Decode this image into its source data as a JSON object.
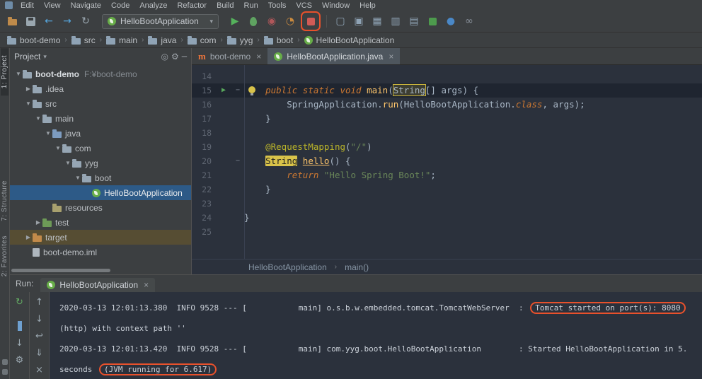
{
  "menu": {
    "items": [
      "Edit",
      "View",
      "Navigate",
      "Code",
      "Analyze",
      "Refactor",
      "Build",
      "Run",
      "Tools",
      "VCS",
      "Window",
      "Help"
    ]
  },
  "toolbar": {
    "run_config": "HelloBootApplication",
    "left": [
      {
        "name": "open-icon",
        "glyph": "folder",
        "color": "#be8a4a"
      },
      {
        "name": "save-icon",
        "glyph": "floppy"
      },
      {
        "name": "back-icon",
        "glyph": "←",
        "color": "#56a8e0"
      },
      {
        "name": "forward-icon",
        "glyph": "→",
        "color": "#56a8e0"
      },
      {
        "name": "refresh-icon",
        "glyph": "↻",
        "color": "#9aa7b0"
      }
    ],
    "run_group": [
      {
        "name": "run-icon",
        "glyph": "▶",
        "color": "#55b25c"
      },
      {
        "name": "debug-icon",
        "glyph": "bug"
      },
      {
        "name": "coverage-icon",
        "glyph": "◉",
        "color": "#b0575a"
      },
      {
        "name": "profiler-icon",
        "glyph": "◔",
        "color": "#c98a3f"
      },
      {
        "name": "stop-icon",
        "glyph": "square",
        "color": "#cf5b56",
        "boxed": true
      }
    ],
    "right": [
      {
        "name": "window-icon",
        "glyph": "▢",
        "color": "#8fa3b5"
      },
      {
        "name": "dock-icon",
        "glyph": "▣",
        "color": "#8fa3b5"
      },
      {
        "name": "grid-icon",
        "glyph": "▦",
        "color": "#8fa3b5"
      },
      {
        "name": "columns-icon",
        "glyph": "▥",
        "color": "#8fa3b5"
      },
      {
        "name": "screens-icon",
        "glyph": "▤",
        "color": "#8fa3b5"
      },
      {
        "name": "green-badge-icon",
        "glyph": "square",
        "color": "#4d9b4d"
      },
      {
        "name": "blue-circle-icon",
        "glyph": "●",
        "color": "#4a88c7"
      },
      {
        "name": "link-icon",
        "glyph": "∞",
        "color": "#88909a"
      }
    ]
  },
  "navbar": {
    "items": [
      {
        "label": "boot-demo",
        "icon": "folder"
      },
      {
        "label": "src",
        "icon": "folder"
      },
      {
        "label": "main",
        "icon": "folder"
      },
      {
        "label": "java",
        "icon": "folder"
      },
      {
        "label": "com",
        "icon": "folder"
      },
      {
        "label": "yyg",
        "icon": "folder"
      },
      {
        "label": "boot",
        "icon": "folder"
      },
      {
        "label": "HelloBootApplication",
        "icon": "spring"
      }
    ]
  },
  "strip": {
    "top": [
      {
        "label": "1: Project",
        "active": true
      }
    ],
    "bottom": [
      {
        "label": "7: Structure"
      },
      {
        "label": "2: Favorites"
      }
    ]
  },
  "project": {
    "title": "Project",
    "tree": [
      {
        "label": "boot-demo",
        "path": "F:¥boot-demo",
        "indent": 0,
        "arrow": "v",
        "icon": "folder",
        "bold": true
      },
      {
        "label": ".idea",
        "indent": 1,
        "arrow": "c",
        "icon": "folder"
      },
      {
        "label": "src",
        "indent": 1,
        "arrow": "v",
        "icon": "folder"
      },
      {
        "label": "main",
        "indent": 2,
        "arrow": "v",
        "icon": "folder"
      },
      {
        "label": "java",
        "indent": 3,
        "arrow": "v",
        "icon": "folder",
        "color": "#7d9cc0"
      },
      {
        "label": "com",
        "indent": 4,
        "arrow": "v",
        "icon": "folder"
      },
      {
        "label": "yyg",
        "indent": 5,
        "arrow": "v",
        "icon": "folder"
      },
      {
        "label": "boot",
        "indent": 6,
        "arrow": "v",
        "icon": "folder"
      },
      {
        "label": "HelloBootApplication",
        "indent": 7,
        "arrow": "",
        "icon": "spring",
        "sel": true
      },
      {
        "label": "resources",
        "indent": 3,
        "arrow": "",
        "icon": "folder",
        "color": "#a8a06e"
      },
      {
        "label": "test",
        "indent": 2,
        "arrow": "c",
        "icon": "folder",
        "color": "#6d9a57"
      },
      {
        "label": "target",
        "indent": 1,
        "arrow": "c",
        "icon": "folder",
        "color": "#c28a4a",
        "olive": true
      },
      {
        "label": "boot-demo.iml",
        "indent": 1,
        "arrow": "",
        "icon": "file"
      }
    ]
  },
  "editor": {
    "tabs": [
      {
        "label": "boot-demo",
        "icon": "maven",
        "active": false
      },
      {
        "label": "HelloBootApplication.java",
        "icon": "spring",
        "active": true
      }
    ],
    "breadcrumb": [
      "HelloBootApplication",
      "main()"
    ],
    "lines": [
      {
        "n": 14,
        "segs": []
      },
      {
        "n": 15,
        "current": true,
        "run": true,
        "bulb": true,
        "fold": "−",
        "segs": [
          {
            "t": "    ",
            "c": "pl"
          },
          {
            "t": "public static void ",
            "c": "kw"
          },
          {
            "t": "main",
            "c": "meth"
          },
          {
            "t": "(",
            "c": "pl"
          },
          {
            "t": "String",
            "c": "cbox"
          },
          {
            "t": "[] args) {",
            "c": "pl"
          }
        ]
      },
      {
        "n": 16,
        "segs": [
          {
            "t": "        SpringApplication.",
            "c": "pl"
          },
          {
            "t": "run",
            "c": "meth"
          },
          {
            "t": "(HelloBootApplication.",
            "c": "pl"
          },
          {
            "t": "class",
            "c": "kw"
          },
          {
            "t": ", args);",
            "c": "pl"
          }
        ]
      },
      {
        "n": 17,
        "segs": [
          {
            "t": "    }",
            "c": "pl"
          }
        ]
      },
      {
        "n": 18,
        "segs": []
      },
      {
        "n": 19,
        "segs": [
          {
            "t": "    ",
            "c": "pl"
          },
          {
            "t": "@RequestMapping",
            "c": "ann"
          },
          {
            "t": "(",
            "c": "pl"
          },
          {
            "t": "\"/\"",
            "c": "str"
          },
          {
            "t": ")",
            "c": "pl"
          }
        ]
      },
      {
        "n": 20,
        "fold": "−",
        "segs": [
          {
            "t": "    ",
            "c": "pl"
          },
          {
            "t": "String",
            "c": "fbox"
          },
          {
            "t": " ",
            "c": "pl"
          },
          {
            "t": "hello",
            "c": "mdecl"
          },
          {
            "t": "() {",
            "c": "pl"
          }
        ]
      },
      {
        "n": 21,
        "segs": [
          {
            "t": "        ",
            "c": "pl"
          },
          {
            "t": "return ",
            "c": "kw"
          },
          {
            "t": "\"Hello Spring Boot!\"",
            "c": "str"
          },
          {
            "t": ";",
            "c": "pl"
          }
        ]
      },
      {
        "n": 22,
        "segs": [
          {
            "t": "    }",
            "c": "pl"
          }
        ]
      },
      {
        "n": 23,
        "segs": []
      },
      {
        "n": 24,
        "segs": [
          {
            "t": "}",
            "c": "pl"
          }
        ]
      },
      {
        "n": 25,
        "segs": []
      }
    ]
  },
  "run": {
    "label": "Run:",
    "tab": "HelloBootApplication",
    "col1": [
      {
        "name": "rerun-icon",
        "glyph": "↻",
        "color": "#62a862"
      },
      {
        "name": "stop-icon",
        "glyph": "square",
        "color": "#c75450"
      },
      {
        "name": "pause-icon",
        "glyph": "pause"
      },
      {
        "name": "dump-threads-icon",
        "glyph": "↓",
        "color": "#9aa7b0"
      },
      {
        "name": "settings-icon",
        "glyph": "⚙",
        "color": "#9aa7b0"
      }
    ],
    "col2": [
      {
        "name": "up-stack-icon",
        "glyph": "↑",
        "color": "#9aa7b0"
      },
      {
        "name": "down-stack-icon",
        "glyph": "↓",
        "color": "#9aa7b0"
      },
      {
        "name": "soft-wrap-icon",
        "glyph": "↩",
        "color": "#9aa7b0"
      },
      {
        "name": "scroll-end-icon",
        "glyph": "⇓",
        "color": "#9aa7b0"
      },
      {
        "name": "clear-icon",
        "glyph": "×",
        "color": "#9aa7b0"
      }
    ],
    "console": [
      {
        "segs": [
          {
            "t": "2020-03-13 12:01:13.380  INFO 9528 --- [           main] o.s.b.w.embedded.tomcat.TomcatWebServer  : "
          },
          {
            "t": "Tomcat started on port(s): 8080",
            "boxed": true
          }
        ]
      },
      {
        "segs": [
          {
            "t": "(http) with context path ''"
          }
        ]
      },
      {
        "segs": [
          {
            "t": "2020-03-13 12:01:13.420  INFO 9528 --- [           main] com.yyg.boot.HelloBootApplication        : Started HelloBootApplication in 5."
          }
        ]
      },
      {
        "segs": [
          {
            "t": "seconds "
          },
          {
            "t": "(JVM running for 6.617)",
            "boxed": true
          }
        ]
      }
    ]
  },
  "colors": {
    "annotation_box": "#e8512c",
    "selected_row": "#2d5a87",
    "excluded_row": "#564d33",
    "editor_bg": "#2b313c"
  }
}
